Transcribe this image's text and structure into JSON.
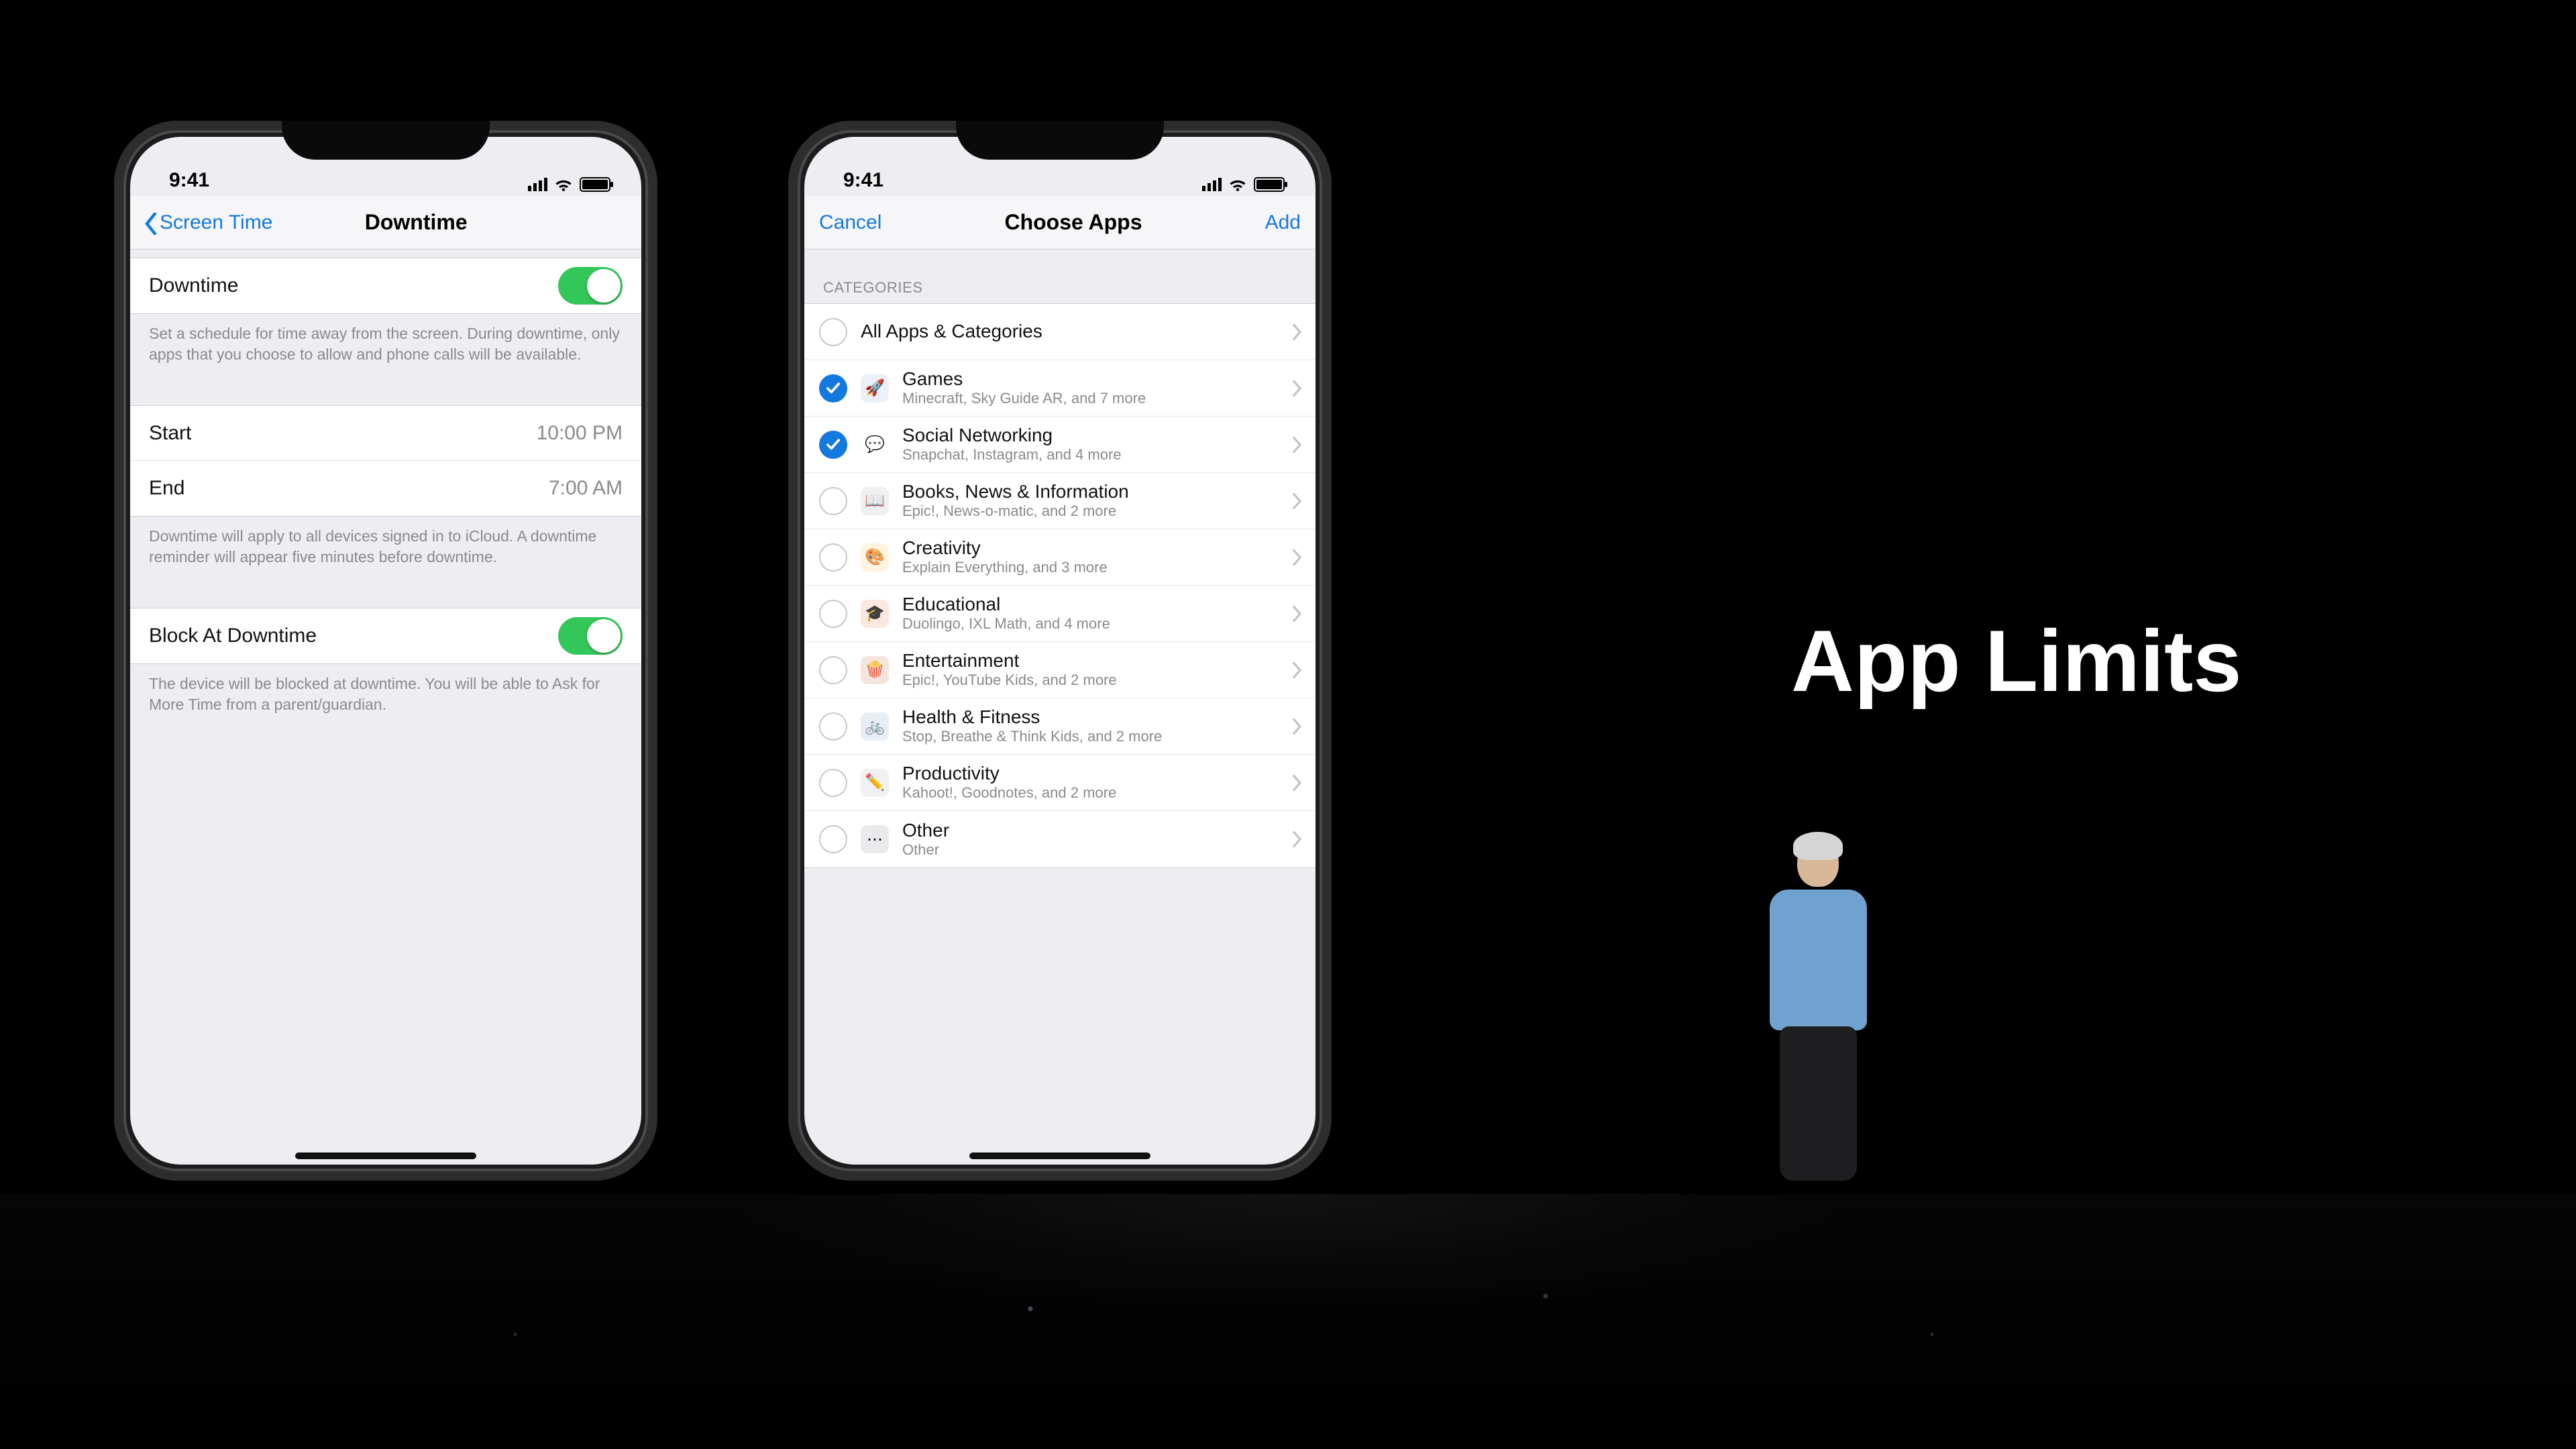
{
  "slide": {
    "title": "App Limits"
  },
  "status": {
    "time": "9:41"
  },
  "phone1": {
    "nav_back": "Screen Time",
    "nav_title": "Downtime",
    "downtime": {
      "switch_label": "Downtime",
      "footer": "Set a schedule for time away from the screen. During downtime, only apps that you choose to allow and phone calls will be available."
    },
    "start": {
      "label": "Start",
      "value": "10:00 PM"
    },
    "end": {
      "label": "End",
      "value": "7:00 AM"
    },
    "schedule_footer": "Downtime will apply to all devices signed in to iCloud. A downtime reminder will appear five minutes before downtime.",
    "block": {
      "label": "Block At Downtime",
      "footer": "The device will be blocked at downtime. You will be able to Ask for More Time from a parent/guardian."
    }
  },
  "phone2": {
    "nav_cancel": "Cancel",
    "nav_title": "Choose Apps",
    "nav_add": "Add",
    "section_header": "CATEGORIES",
    "all_row": {
      "label": "All Apps & Categories"
    },
    "categories": [
      {
        "checked": true,
        "icon_bg": "#e9f0f8",
        "icon_emoji": "🚀",
        "label": "Games",
        "sub": "Minecraft, Sky Guide AR, and 7 more"
      },
      {
        "checked": true,
        "icon_bg": "#ffffff",
        "icon_emoji": "💬",
        "label": "Social Networking",
        "sub": "Snapchat, Instagram, and 4 more"
      },
      {
        "checked": false,
        "icon_bg": "#eef0f2",
        "icon_emoji": "📖",
        "label": "Books, News & Information",
        "sub": "Epic!, News-o-matic, and 2 more"
      },
      {
        "checked": false,
        "icon_bg": "#fff4df",
        "icon_emoji": "🎨",
        "label": "Creativity",
        "sub": "Explain Everything, and 3 more"
      },
      {
        "checked": false,
        "icon_bg": "#fde7e1",
        "icon_emoji": "🎓",
        "label": "Educational",
        "sub": "Duolingo, IXL Math, and 4 more"
      },
      {
        "checked": false,
        "icon_bg": "#f4e5df",
        "icon_emoji": "🍿",
        "label": "Entertainment",
        "sub": "Epic!, YouTube Kids, and 2 more"
      },
      {
        "checked": false,
        "icon_bg": "#e7eef5",
        "icon_emoji": "🚲",
        "label": "Health & Fitness",
        "sub": "Stop, Breathe & Think Kids, and 2 more"
      },
      {
        "checked": false,
        "icon_bg": "#eff1f3",
        "icon_emoji": "✏️",
        "label": "Productivity",
        "sub": "Kahoot!, Goodnotes, and 2 more"
      },
      {
        "checked": false,
        "icon_bg": "#eaeaec",
        "icon_emoji": "⋯",
        "label": "Other",
        "sub": "Other"
      }
    ]
  }
}
